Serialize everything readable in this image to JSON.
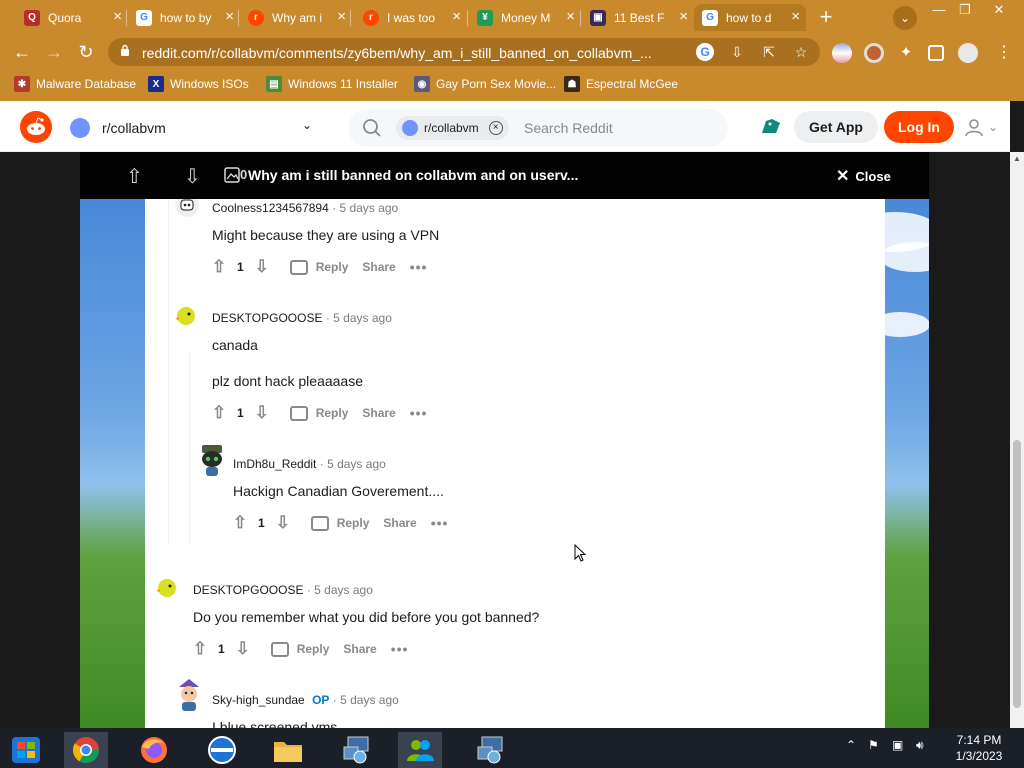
{
  "browser": {
    "tabs": [
      {
        "label": "Quora",
        "fav": "Q",
        "fav_color": "#b92b27",
        "active": false
      },
      {
        "label": "how to by",
        "fav": "G",
        "fav_color": "#ffffff",
        "active": false
      },
      {
        "label": "Why am i",
        "fav": "r",
        "fav_color": "#ff4500",
        "active": false
      },
      {
        "label": "I was too",
        "fav": "r",
        "fav_color": "#ff4500",
        "active": false
      },
      {
        "label": "Money M",
        "fav": "¥",
        "fav_color": "#1f9d55",
        "active": false
      },
      {
        "label": "11 Best F",
        "fav": "▣",
        "fav_color": "#3b2a55",
        "active": false
      },
      {
        "label": "how to d",
        "fav": "G",
        "fav_color": "#ffffff",
        "active": true
      }
    ],
    "url": "reddit.com/r/collabvm/comments/zy6bem/why_am_i_still_banned_on_collabvm_...",
    "bookmarks": [
      {
        "label": "Malware Database",
        "icon_color": "#b33b2b"
      },
      {
        "label": "Windows ISOs",
        "icon_color": "#1a2b8c"
      },
      {
        "label": "Windows 11 Installer",
        "icon_color": "#4a8c3a"
      },
      {
        "label": "Gay Porn Sex Movie...",
        "icon_color": "#5a5a7a"
      },
      {
        "label": "Espectral McGee",
        "icon_color": "#3a2a1a"
      }
    ],
    "accent": "#c98a2e"
  },
  "reddit": {
    "community": "r/collabvm",
    "search_chip": "r/collabvm",
    "search_placeholder": "Search Reddit",
    "get_app": "Get App",
    "login": "Log In",
    "brand_color": "#ff4500"
  },
  "post": {
    "score": "0",
    "title": "Why am i still banned on collabvm and on userv...",
    "close_label": "Close"
  },
  "comments": [
    {
      "author": "Coolness1234567894",
      "time": "5 days ago",
      "op": "",
      "lines": [
        "Might because they are using a VPN"
      ],
      "votes": "1",
      "avatar": "robot"
    },
    {
      "author": "DESKTOPGOOOSE",
      "time": "5 days ago",
      "op": "",
      "lines": [
        "canada",
        "plz dont hack pleaaaase"
      ],
      "votes": "1",
      "avatar": "goose"
    },
    {
      "author": "ImDh8u_Reddit",
      "time": "5 days ago",
      "op": "",
      "lines": [
        "Hackign Canadian Goverement...."
      ],
      "votes": "1",
      "avatar": "alien"
    },
    {
      "author": "DESKTOPGOOOSE",
      "time": "5 days ago",
      "op": "",
      "lines": [
        "Do you remember what you did before you got banned?"
      ],
      "votes": "1",
      "avatar": "goose"
    },
    {
      "author": "Sky-high_sundae",
      "time": "5 days ago",
      "op": "OP",
      "lines": [
        "I blue screened vms"
      ],
      "votes": "",
      "avatar": "hat"
    }
  ],
  "actions": {
    "reply": "Reply",
    "share": "Share",
    "more": "•••"
  },
  "taskbar": {
    "time": "7:14 PM",
    "date": "1/3/2023",
    "apps": [
      "windows-explorer-icon",
      "chrome-icon",
      "firefox-icon",
      "edge-icon",
      "file-explorer-icon",
      "network-app-icon",
      "users-app-icon",
      "network-app-icon"
    ]
  }
}
